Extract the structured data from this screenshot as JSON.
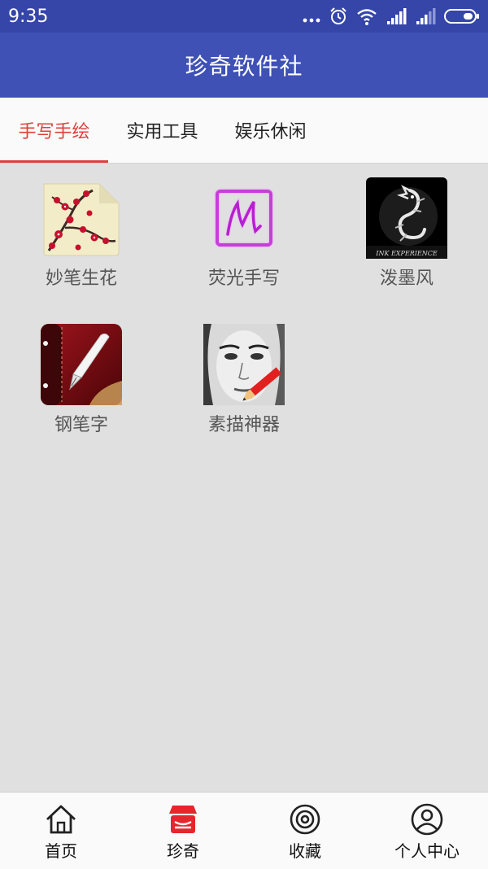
{
  "status": {
    "time": "9:35"
  },
  "app_title": "珍奇软件社",
  "tabs": [
    {
      "label": "手写手绘",
      "active": true
    },
    {
      "label": "实用工具",
      "active": false
    },
    {
      "label": "娱乐休闲",
      "active": false
    }
  ],
  "apps": [
    {
      "label": "妙笔生花",
      "icon": "plum-blossom-icon"
    },
    {
      "label": "荧光手写",
      "icon": "neon-m-icon"
    },
    {
      "label": "泼墨风",
      "icon": "dragon-ink-icon"
    },
    {
      "label": "钢笔字",
      "icon": "fountain-pen-icon"
    },
    {
      "label": "素描神器",
      "icon": "sketch-face-icon"
    }
  ],
  "bottom_nav": [
    {
      "label": "首页",
      "icon": "home-icon",
      "active": false
    },
    {
      "label": "珍奇",
      "icon": "shop-icon",
      "active": true
    },
    {
      "label": "收藏",
      "icon": "target-icon",
      "active": false
    },
    {
      "label": "个人中心",
      "icon": "user-icon",
      "active": false
    }
  ],
  "colors": {
    "primary": "#3f51b5",
    "status_bar": "#3545a8",
    "accent": "#e0403d",
    "background": "#e0e0e0"
  }
}
